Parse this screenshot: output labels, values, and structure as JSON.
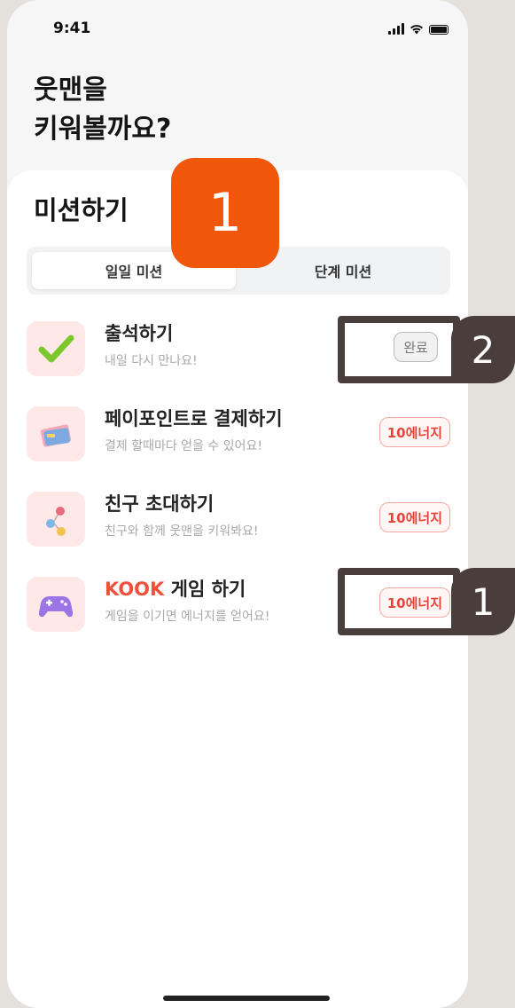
{
  "status": {
    "time": "9:41"
  },
  "headline": {
    "line1": "웃맨을",
    "line2": "키워볼까요?"
  },
  "sheet": {
    "title": "미션하기"
  },
  "tabs": [
    {
      "label": "일일 미션",
      "active": true
    },
    {
      "label": "단계 미션",
      "active": false
    }
  ],
  "missions": [
    {
      "title": "출석하기",
      "subtitle": "내일 다시 만나요!",
      "badge": "완료",
      "icon": "checkmark-icon",
      "completed": true
    },
    {
      "title": "페이포인트로 결제하기",
      "subtitle": "결제 할때마다 얻을 수 있어요!",
      "badge": "10에너지",
      "icon": "credit-card-icon",
      "completed": false
    },
    {
      "title": "친구 초대하기",
      "subtitle": "친구와 함께 웃맨을 키워봐요!",
      "badge": "10에너지",
      "icon": "friends-icon",
      "completed": false
    },
    {
      "title_brand": "KOOK",
      "title_rest": " 게임 하기",
      "subtitle": "게임을 이기면 에너지를 얻어요!",
      "badge": "10에너지",
      "icon": "game-controller-icon",
      "completed": false
    }
  ],
  "annotations": {
    "marker_title": "1",
    "marker_done": "2",
    "marker_game": "1"
  },
  "colors": {
    "accent": "#f0503c",
    "annotation_orange": "#f0570a",
    "annotation_dark": "#4a3e3d"
  }
}
